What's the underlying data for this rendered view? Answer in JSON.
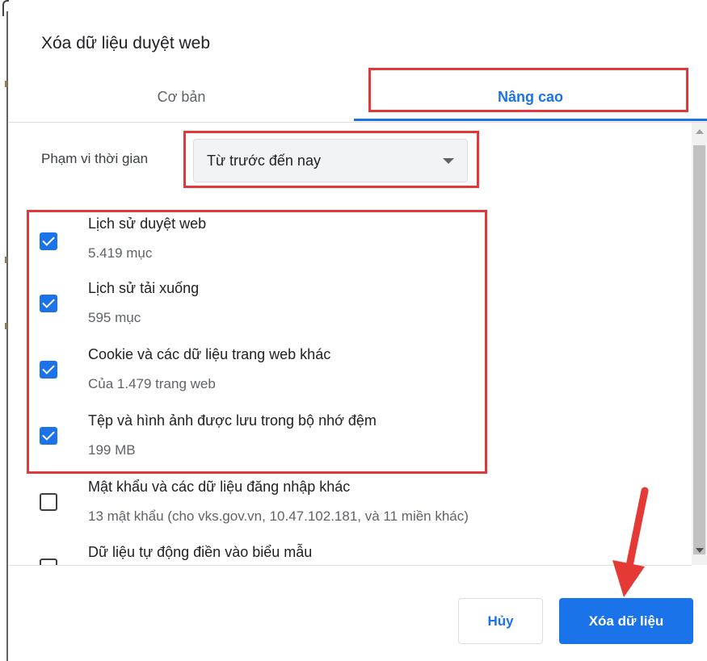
{
  "dialog": {
    "title": "Xóa dữ liệu duyệt web"
  },
  "tabs": [
    {
      "label": "Cơ bản",
      "selected": false
    },
    {
      "label": "Nâng cao",
      "selected": true
    }
  ],
  "time_range": {
    "label": "Phạm vi thời gian",
    "selected": "Từ trước đến nay"
  },
  "items": [
    {
      "title": "Lịch sử duyệt web",
      "subtitle": "5.419 mục",
      "checked": true
    },
    {
      "title": "Lịch sử tải xuống",
      "subtitle": "595 mục",
      "checked": true
    },
    {
      "title": "Cookie và các dữ liệu trang web khác",
      "subtitle": "Của 1.479 trang web",
      "checked": true
    },
    {
      "title": "Tệp và hình ảnh được lưu trong bộ nhớ đệm",
      "subtitle": "199 MB",
      "checked": true
    },
    {
      "title": "Mật khẩu và các dữ liệu đăng nhập khác",
      "subtitle": "13 mật khẩu (cho vks.gov.vn, 10.47.102.181, và 11 miền khác)",
      "checked": false
    },
    {
      "title": "Dữ liệu tự động điền vào biểu mẫu",
      "subtitle": "",
      "checked": false
    }
  ],
  "buttons": {
    "cancel": "Hủy",
    "clear": "Xóa dữ liệu"
  },
  "colors": {
    "accent": "#1a73e8",
    "highlight": "#e3373a",
    "arrow": "#e53935"
  },
  "icons": {
    "dropdown": "caret-down-icon",
    "checkbox": "checkbox-icon",
    "annotation": "red-arrow-icon"
  }
}
